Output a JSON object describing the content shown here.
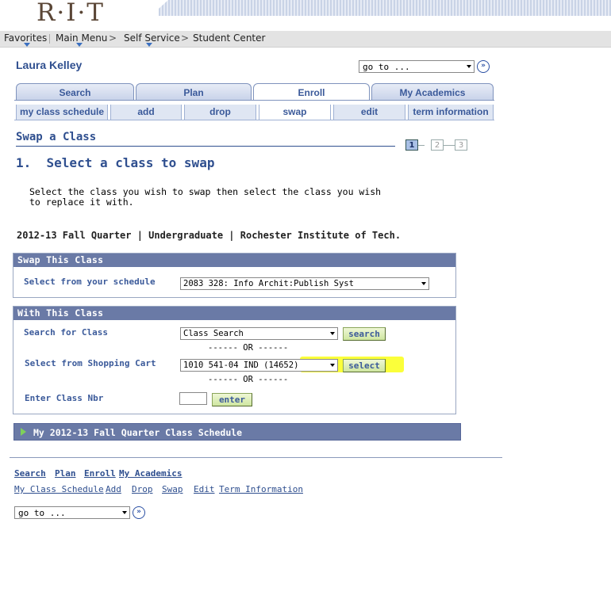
{
  "header": {
    "logo_text": "R·I·T",
    "nav": [
      "Favorites",
      "Main Menu",
      "Self Service",
      "Student Center"
    ]
  },
  "student_name": "Laura Kelley",
  "goto": {
    "value": "go to ...",
    "go_glyph": "»"
  },
  "main_tabs": [
    "Search",
    "Plan",
    "Enroll",
    "My Academics"
  ],
  "active_main_tab": "Enroll",
  "sub_tabs": [
    "my class schedule",
    "add",
    "drop",
    "swap",
    "edit",
    "term information"
  ],
  "active_sub_tab": "swap",
  "page_title": "Swap a Class",
  "steps": [
    "1",
    "2",
    "3"
  ],
  "current_step": 1,
  "step_heading": "1.  Select a class to swap",
  "instructions": "Select the class you wish to swap then select the class you wish to replace it with.",
  "term_line": "2012-13 Fall Quarter | Undergraduate | Rochester Institute of Tech.",
  "swap_panel": {
    "title": "Swap This Class",
    "label": "Select from your schedule",
    "value": "2083 328: Info Archit:Publish Syst"
  },
  "with_panel": {
    "title": "With This Class",
    "search_label": "Search for Class",
    "search_value": "Class Search",
    "search_button": "search",
    "or_1": "------ OR ------",
    "cart_label": "Select from Shopping Cart",
    "cart_value": "1010 541-04 IND (14652)",
    "select_button": "select",
    "or_2": "------ OR ------",
    "nbr_label": "Enter Class Nbr",
    "nbr_value": "",
    "enter_button": "enter"
  },
  "schedule_bar": "My 2012-13 Fall Quarter Class Schedule",
  "bottom_links_1": [
    "Search",
    "Plan",
    "Enroll",
    "My Academics"
  ],
  "bottom_links_2": [
    "My Class Schedule",
    "Add",
    "Drop",
    "Swap",
    "Edit",
    "Term Information"
  ],
  "colors": {
    "header_blue": "#2f4f8f",
    "panel_head": "#6a7aa6",
    "highlight": "#fbff3a",
    "button_green": "#cfe6a0"
  }
}
